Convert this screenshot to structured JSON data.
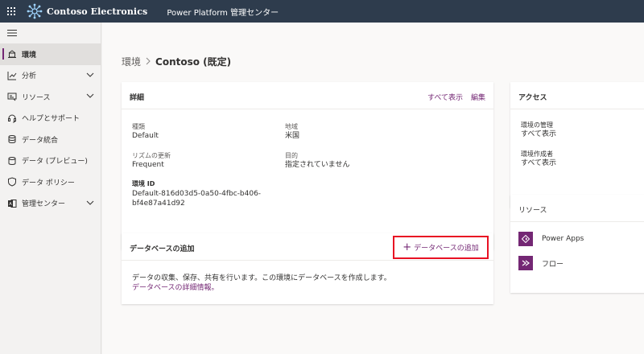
{
  "topbar": {
    "brand": "Contoso Electronics",
    "app_title": "Power Platform 管理センター"
  },
  "sidebar": {
    "items": [
      {
        "label": "環境",
        "icon": "environment-icon",
        "active": true
      },
      {
        "label": "分析",
        "icon": "analytics-icon"
      },
      {
        "label": "リソース",
        "icon": "resources-icon"
      },
      {
        "label": "ヘルプとサポート",
        "icon": "help-headset-icon"
      },
      {
        "label": "データ統合",
        "icon": "data-integration-icon"
      },
      {
        "label": "データ (プレビュー)",
        "icon": "data-preview-icon"
      },
      {
        "label": "データ ポリシー",
        "icon": "shield-icon"
      },
      {
        "label": "管理センター",
        "icon": "admin-centers-icon"
      }
    ]
  },
  "breadcrumb": {
    "root": "環境",
    "current": "Contoso (既定)"
  },
  "details": {
    "title": "詳細",
    "show_all": "すべて表示",
    "edit": "編集",
    "type_label": "種類",
    "type_value": "Default",
    "region_label": "地域",
    "region_value": "米国",
    "cadence_label": "リズムの更新",
    "cadence_value": "Frequent",
    "purpose_label": "目的",
    "purpose_value": "指定されていません",
    "env_id_label": "環境 ID",
    "env_id_line1": "Default-816d03d5-0a50-4fbc-b406-",
    "env_id_line2": "bf4e87a41d92"
  },
  "database": {
    "title": "データベースの追加",
    "add_button": "データベースの追加",
    "description": "データの収集、保存、共有を行います。この環境にデータベースを作成します。",
    "learn_more": "データベースの詳細情報。"
  },
  "access": {
    "title": "アクセス",
    "env_admin_label": "環境の管理",
    "env_admin_link": "すべて表示",
    "env_maker_label": "環境作成者",
    "env_maker_link": "すべて表示"
  },
  "resources": {
    "title": "リソース",
    "items": [
      {
        "label": "Power Apps",
        "icon": "power-apps-icon"
      },
      {
        "label": "フロー",
        "icon": "flow-icon"
      }
    ]
  },
  "colors": {
    "topbar": "#2e3c4d",
    "accent": "#742774",
    "highlight": "#e81123"
  }
}
